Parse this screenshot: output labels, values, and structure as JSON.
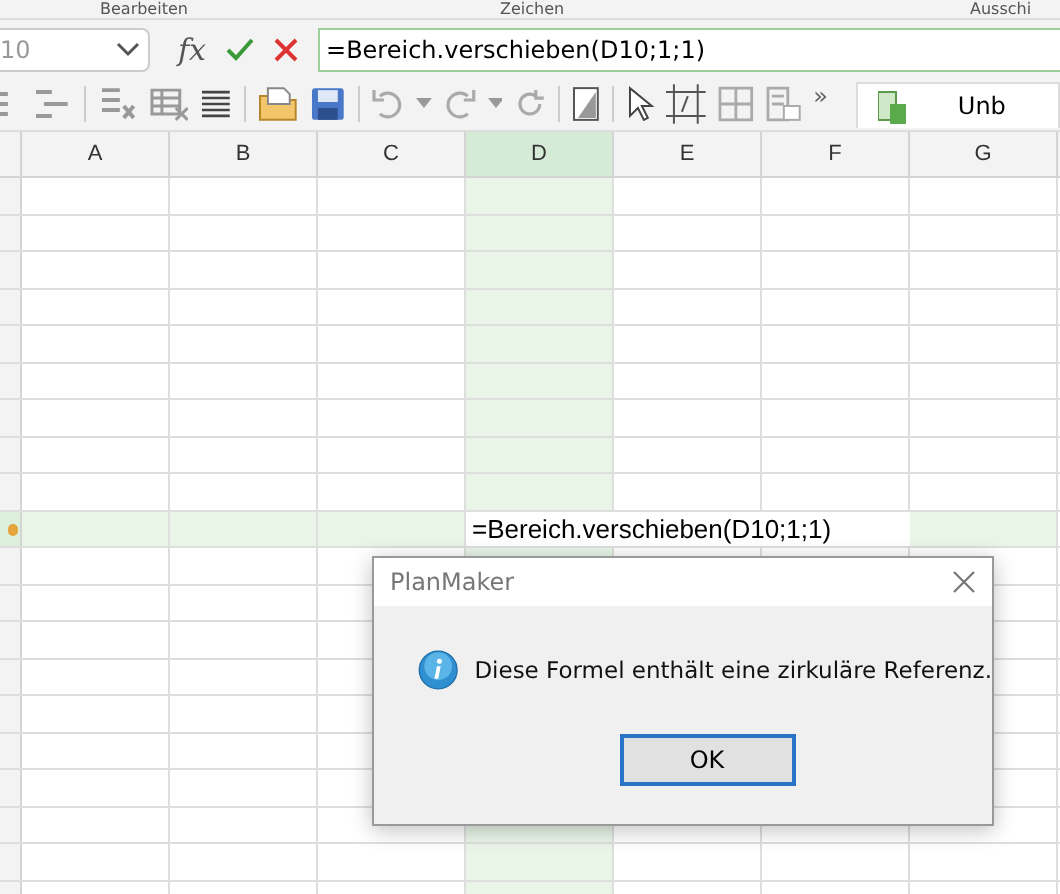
{
  "ribbon_groups": [
    {
      "label": "Bearbeiten"
    },
    {
      "label": "Zeichen"
    },
    {
      "label": "Ausschi"
    }
  ],
  "formula_bar": {
    "name_box": "10",
    "function_icon": "fx",
    "formula": "=Bereich.verschieben(D10;1;1)"
  },
  "toolbar": {
    "overflow": "»",
    "document_tab": "Unb"
  },
  "columns": [
    {
      "label": "A",
      "selected": false
    },
    {
      "label": "B",
      "selected": false
    },
    {
      "label": "C",
      "selected": false
    },
    {
      "label": "D",
      "selected": true
    },
    {
      "label": "E",
      "selected": false
    },
    {
      "label": "F",
      "selected": false
    },
    {
      "label": "G",
      "selected": false
    }
  ],
  "rows": [
    {
      "selected": false
    },
    {
      "selected": false
    },
    {
      "selected": false
    },
    {
      "selected": false
    },
    {
      "selected": false
    },
    {
      "selected": false
    },
    {
      "selected": false
    },
    {
      "selected": false
    },
    {
      "selected": false
    },
    {
      "selected": true
    },
    {
      "selected": false
    },
    {
      "selected": false
    },
    {
      "selected": false
    },
    {
      "selected": false
    },
    {
      "selected": false
    },
    {
      "selected": false
    },
    {
      "selected": false
    },
    {
      "selected": false
    },
    {
      "selected": false
    },
    {
      "selected": false
    }
  ],
  "active_cell_text": "=Bereich.verschieben(D10;1;1)",
  "dialog": {
    "title": "PlanMaker",
    "message": "Diese Formel enthält eine zirkuläre Referenz.",
    "button": "OK"
  }
}
